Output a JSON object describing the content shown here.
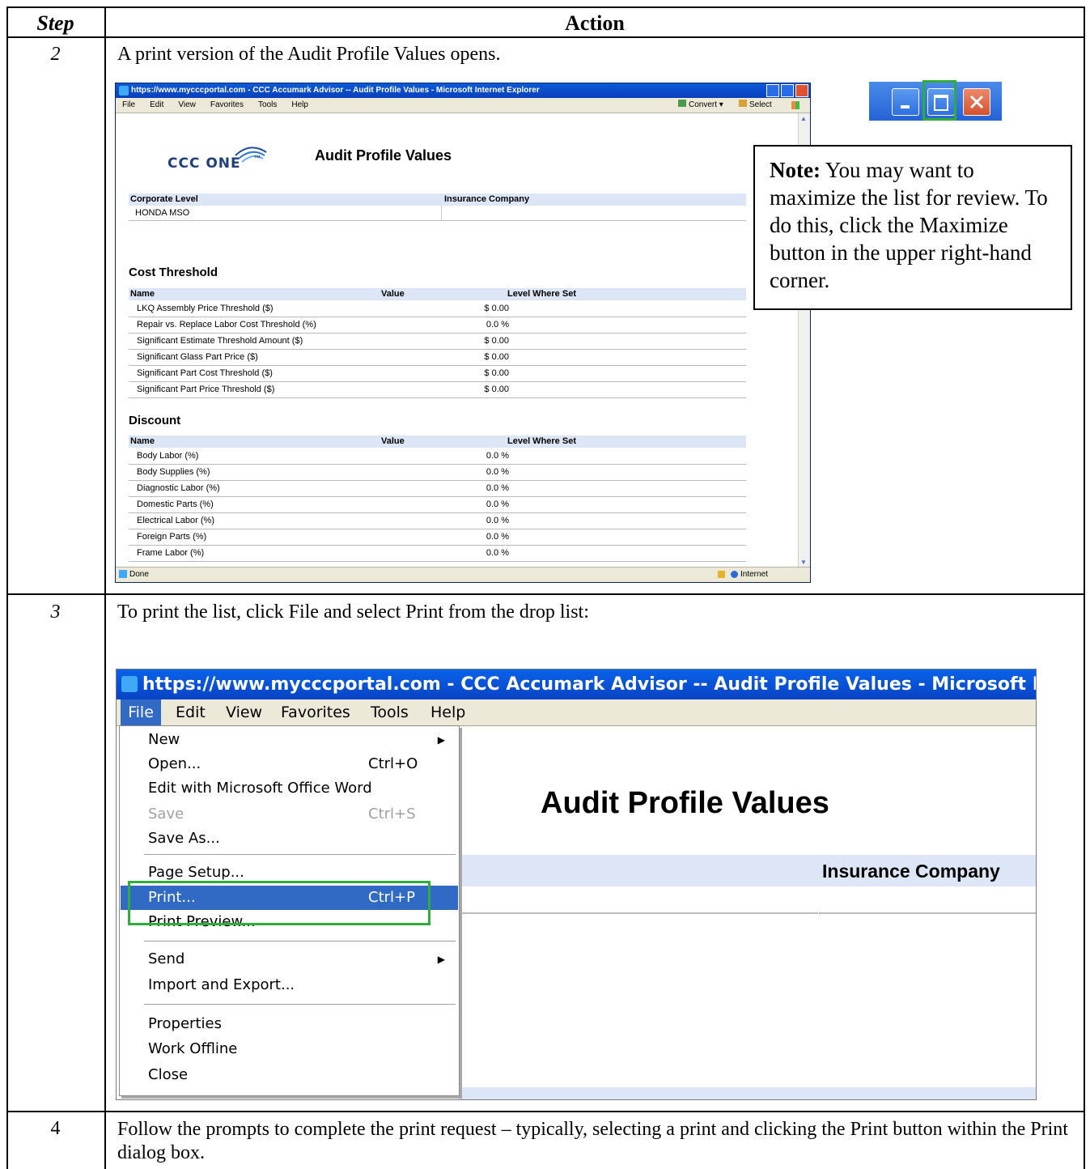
{
  "headers": {
    "step": "Step",
    "action": "Action"
  },
  "rows": [
    {
      "step": "2",
      "text": "A print version of the Audit Profile Values opens."
    },
    {
      "step": "3",
      "text": "To print the list, click File and select Print from the drop list:"
    },
    {
      "step": "4",
      "text": "Follow the prompts to complete the print request – typically, selecting a print and clicking the Print button within the Print dialog box."
    }
  ],
  "note": {
    "label": "Note:",
    "text": "You may want to maximize the list for review.  To do this, click the Maximize button in the upper right-hand corner."
  },
  "ie": {
    "title": "https://www.mycccportal.com - CCC Accumark Advisor -- Audit Profile Values - Microsoft Internet Explorer",
    "title_zoom": "https://www.mycccportal.com - CCC Accumark Advisor -- Audit Profile Values - Microsoft Internet",
    "menu": [
      "File",
      "Edit",
      "View",
      "Favorites",
      "Tools",
      "Help"
    ],
    "toolbar": {
      "convert": "Convert",
      "select": "Select"
    },
    "status_left": "Done",
    "status_right": "Internet"
  },
  "report": {
    "logo": "CCC ONE",
    "logo_tm": "™",
    "title": "Audit Profile Values",
    "corp_header": "Corporate Level",
    "ins_header": "Insurance Company",
    "corp_value": "HONDA MSO",
    "col_name": "Name",
    "col_value": "Value",
    "col_level": "Level Where Set",
    "cost_title": "Cost Threshold",
    "cost_rows": [
      {
        "name": "LKQ Assembly Price Threshold ($)",
        "value": "$ 0.00"
      },
      {
        "name": "Repair vs. Replace Labor Cost Threshold (%)",
        "value": "0.0 %"
      },
      {
        "name": "Significant Estimate Threshold Amount ($)",
        "value": "$ 0.00"
      },
      {
        "name": "Significant Glass Part Price ($)",
        "value": "$ 0.00"
      },
      {
        "name": "Significant Part Cost Threshold ($)",
        "value": "$ 0.00"
      },
      {
        "name": "Significant Part Price Threshold ($)",
        "value": "$ 0.00"
      }
    ],
    "discount_title": "Discount",
    "discount_rows": [
      {
        "name": "Body Labor (%)",
        "value": "0.0 %"
      },
      {
        "name": "Body Supplies (%)",
        "value": "0.0 %"
      },
      {
        "name": "Diagnostic Labor (%)",
        "value": "0.0 %"
      },
      {
        "name": "Domestic Parts (%)",
        "value": "0.0 %"
      },
      {
        "name": "Electrical Labor (%)",
        "value": "0.0 %"
      },
      {
        "name": "Foreign Parts (%)",
        "value": "0.0 %"
      },
      {
        "name": "Frame Labor (%)",
        "value": "0.0 %"
      }
    ]
  },
  "file_menu": {
    "new": "New",
    "open": "Open...",
    "open_sc": "Ctrl+O",
    "edit_word": "Edit with Microsoft Office Word",
    "save": "Save",
    "save_sc": "Ctrl+S",
    "save_as": "Save As...",
    "page_setup": "Page Setup...",
    "print": "Print...",
    "print_sc": "Ctrl+P",
    "print_preview": "Print Preview...",
    "send": "Send",
    "import_export": "Import and Export...",
    "properties": "Properties",
    "work_offline": "Work Offline",
    "close": "Close"
  },
  "colors": {
    "highlight": "#316ac5",
    "callout": "#2ead3a",
    "titlebar": "#0b4fd0"
  }
}
